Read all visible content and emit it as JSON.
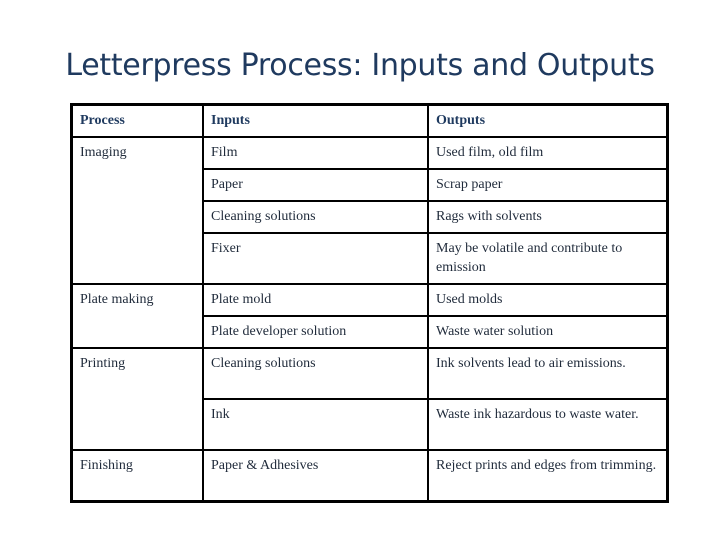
{
  "title": "Letterpress Process: Inputs and Outputs",
  "table": {
    "headers": [
      "Process",
      "Inputs",
      "Outputs"
    ],
    "rows": [
      {
        "process": "Imaging",
        "input": "Film",
        "output": "Used film, old film"
      },
      {
        "process": "",
        "input": "Paper",
        "output": "Scrap paper"
      },
      {
        "process": "",
        "input": "Cleaning solutions",
        "output": "Rags with solvents"
      },
      {
        "process": "",
        "input": "Fixer",
        "output": "May be volatile and contribute to emission"
      },
      {
        "process": "Plate making",
        "input": "Plate mold",
        "output": "Used molds"
      },
      {
        "process": "",
        "input": "Plate developer solution",
        "output": "Waste water solution"
      },
      {
        "process": "Printing",
        "input": "Cleaning solutions",
        "output": "Ink solvents lead to air emissions."
      },
      {
        "process": "",
        "input": "Ink",
        "output": "Waste ink hazardous to waste water."
      },
      {
        "process": "Finishing",
        "input": "Paper & Adhesives",
        "output": "Reject prints and edges from trimming."
      }
    ]
  }
}
